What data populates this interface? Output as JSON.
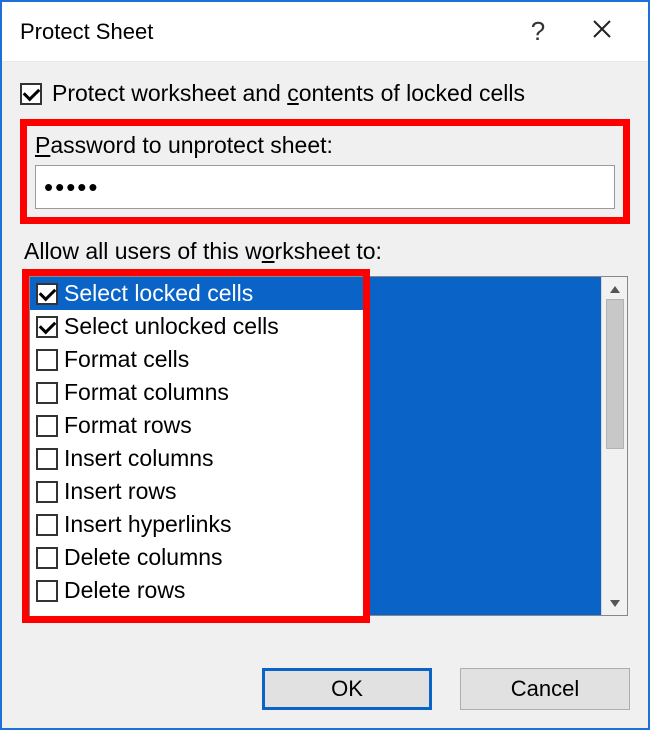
{
  "title": "Protect Sheet",
  "protect_label_pre": "Protect worksheet and ",
  "protect_label_ul": "c",
  "protect_label_post": "ontents of locked cells",
  "protect_checked": true,
  "password_label_ul": "P",
  "password_label_rest": "assword to unprotect sheet:",
  "password_value": "•••••",
  "allow_label_pre": "Allow all users of this w",
  "allow_label_ul": "o",
  "allow_label_post": "rksheet to:",
  "permissions": [
    {
      "label": "Select locked cells",
      "checked": true,
      "selected": true
    },
    {
      "label": "Select unlocked cells",
      "checked": true,
      "selected": false
    },
    {
      "label": "Format cells",
      "checked": false,
      "selected": false
    },
    {
      "label": "Format columns",
      "checked": false,
      "selected": false
    },
    {
      "label": "Format rows",
      "checked": false,
      "selected": false
    },
    {
      "label": "Insert columns",
      "checked": false,
      "selected": false
    },
    {
      "label": "Insert rows",
      "checked": false,
      "selected": false
    },
    {
      "label": "Insert hyperlinks",
      "checked": false,
      "selected": false
    },
    {
      "label": "Delete columns",
      "checked": false,
      "selected": false
    },
    {
      "label": "Delete rows",
      "checked": false,
      "selected": false
    }
  ],
  "buttons": {
    "ok": "OK",
    "cancel": "Cancel"
  },
  "colors": {
    "accent": "#0a63c7",
    "highlight_border": "#ff0000"
  }
}
